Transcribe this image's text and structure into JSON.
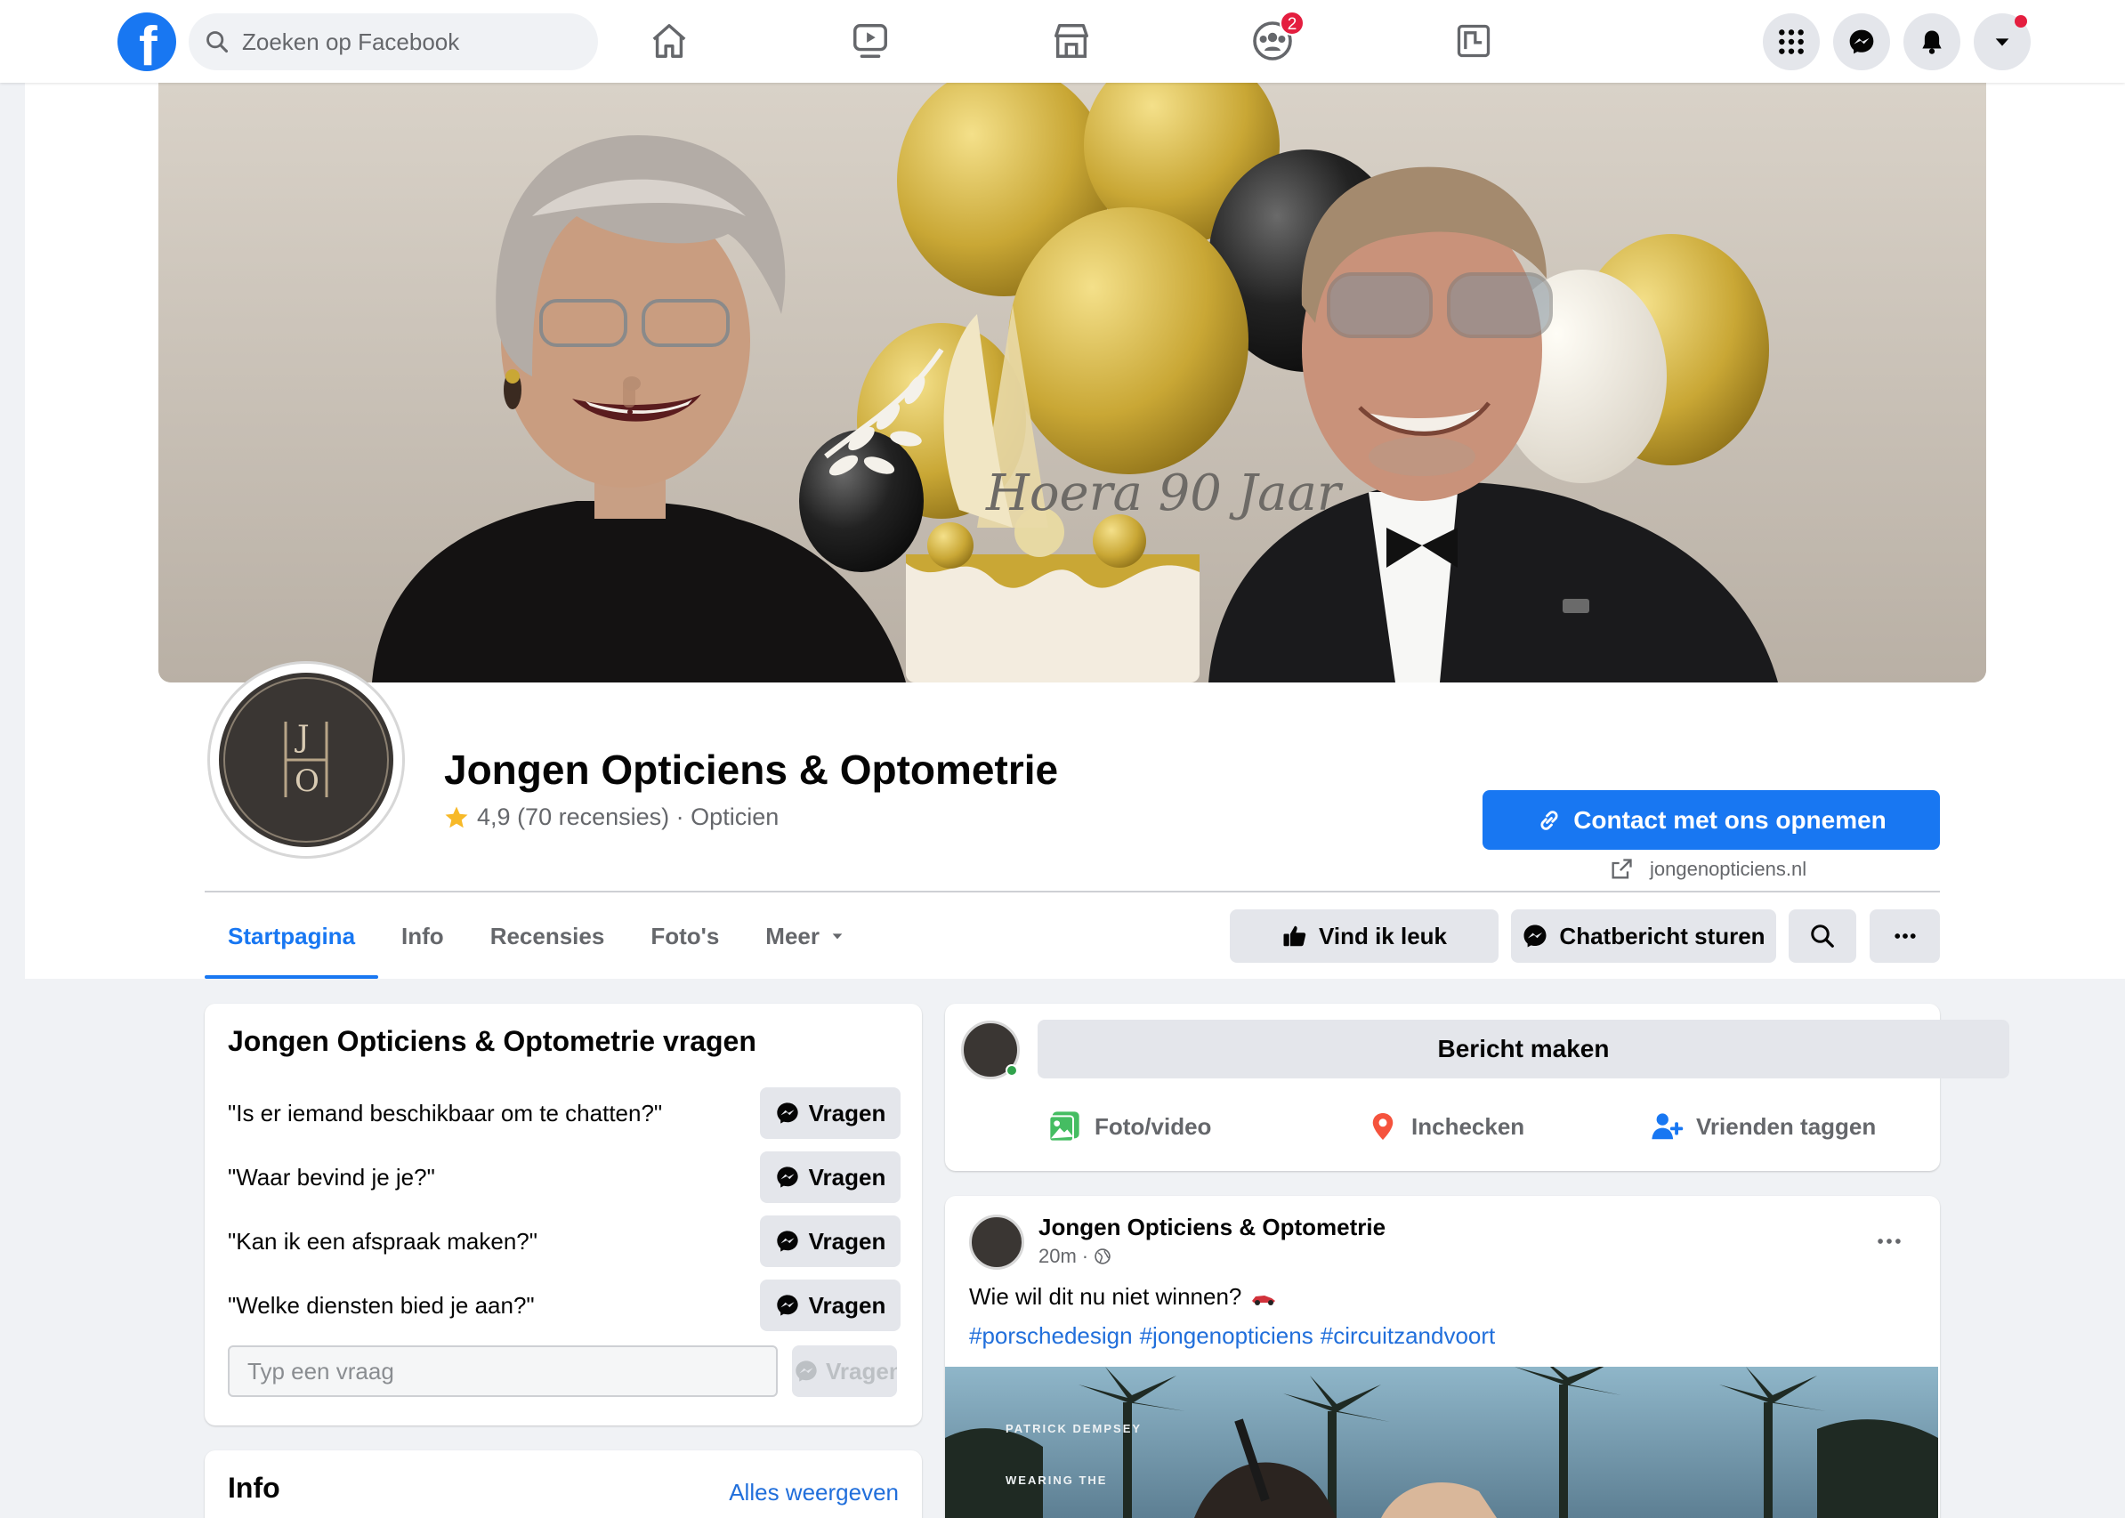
{
  "topbar": {
    "search_placeholder": "Zoeken op Facebook",
    "groups_badge": "2"
  },
  "page": {
    "name": "Jongen Opticiens & Optometrie",
    "rating": "4,9",
    "reviews": "(70 recensies)",
    "separator": "·",
    "category": "Opticien",
    "logo_top": "J",
    "logo_bottom": "O",
    "contact_button": "Contact met ons opnemen",
    "website": "jongenopticiens.nl",
    "cover_cake_text": "Hoera 90 Jaar"
  },
  "tabs": [
    {
      "label": "Startpagina",
      "active": true
    },
    {
      "label": "Info"
    },
    {
      "label": "Recensies"
    },
    {
      "label": "Foto's"
    },
    {
      "label": "Meer"
    }
  ],
  "actions": {
    "like": "Vind ik leuk",
    "message": "Chatbericht sturen"
  },
  "questions_card": {
    "title": "Jongen Opticiens & Optometrie vragen",
    "questions": [
      "\"Is er iemand beschikbaar om te chatten?\"",
      "\"Waar bevind je je?\"",
      "\"Kan ik een afspraak maken?\"",
      "\"Welke diensten bied je aan?\""
    ],
    "ask_label": "Vragen",
    "input_placeholder": "Typ een vraag"
  },
  "info_card": {
    "title": "Info",
    "see_all": "Alles weergeven"
  },
  "composer": {
    "button": "Bericht maken",
    "photo": "Foto/video",
    "checkin": "Inchecken",
    "tag": "Vrienden taggen"
  },
  "post": {
    "author": "Jongen Opticiens & Optometrie",
    "time": "20m",
    "dot": "·",
    "text": "Wie wil dit nu niet winnen?",
    "hashtags": [
      "#porschedesign",
      "#jongenopticiens",
      "#circuitzandvoort"
    ],
    "image_text_1": "PATRICK DEMPSEY",
    "image_text_2": "WEARING THE"
  },
  "colors": {
    "primary": "#1877f2",
    "badge": "#e41e3f",
    "background": "#f0f2f5"
  }
}
